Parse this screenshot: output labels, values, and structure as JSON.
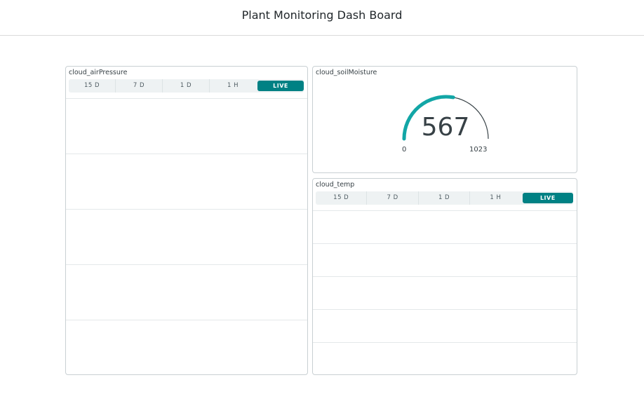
{
  "header": {
    "title": "Plant Monitoring Dash Board"
  },
  "widgets": {
    "air_pressure": {
      "title": "cloud_airPressure",
      "ranges": [
        "15 D",
        "7 D",
        "1 D",
        "1 H",
        "LIVE"
      ],
      "selected_range": "LIVE"
    },
    "soil_moisture": {
      "title": "cloud_soilMoisture",
      "value": "567",
      "min": "0",
      "max": "1023",
      "value_num": 567,
      "min_num": 0,
      "max_num": 1023
    },
    "temp": {
      "title": "cloud_temp",
      "ranges": [
        "15 D",
        "7 D",
        "1 D",
        "1 H",
        "LIVE"
      ],
      "selected_range": "LIVE"
    }
  },
  "colors": {
    "accent": "#008184",
    "gauge_fill": "#12a6a6",
    "gauge_track": "#374146"
  }
}
